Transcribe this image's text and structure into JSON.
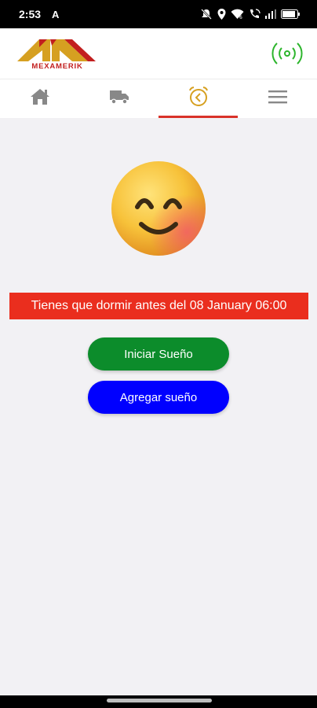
{
  "status_bar": {
    "time": "2:53",
    "notification_letter": "A",
    "icons": [
      "mute-icon",
      "location-icon",
      "wifi-icon",
      "wifi-call-icon",
      "cell-signal-icon",
      "battery-icon"
    ]
  },
  "header": {
    "logo_text": "MEXAMERIK",
    "logo_colors": {
      "primary": "#d6a021",
      "accent": "#c21f1f"
    },
    "signal_icon_color": "#2cb52c"
  },
  "nav": {
    "tabs": [
      {
        "icon": "home-icon",
        "active": false
      },
      {
        "icon": "truck-icon",
        "active": false
      },
      {
        "icon": "alarm-clock-icon",
        "active": true
      },
      {
        "icon": "menu-icon",
        "active": false
      }
    ],
    "active_color": "#d9322a"
  },
  "main": {
    "emoji": "smiling-face-icon",
    "message": "Tienes que dormir antes del 08 January 06:00",
    "start_button": "Iniciar Sueño",
    "add_button": "Agregar sueño",
    "colors": {
      "banner": "#ea2e1e",
      "start": "#0c8c2b",
      "add": "#0000ff"
    }
  }
}
